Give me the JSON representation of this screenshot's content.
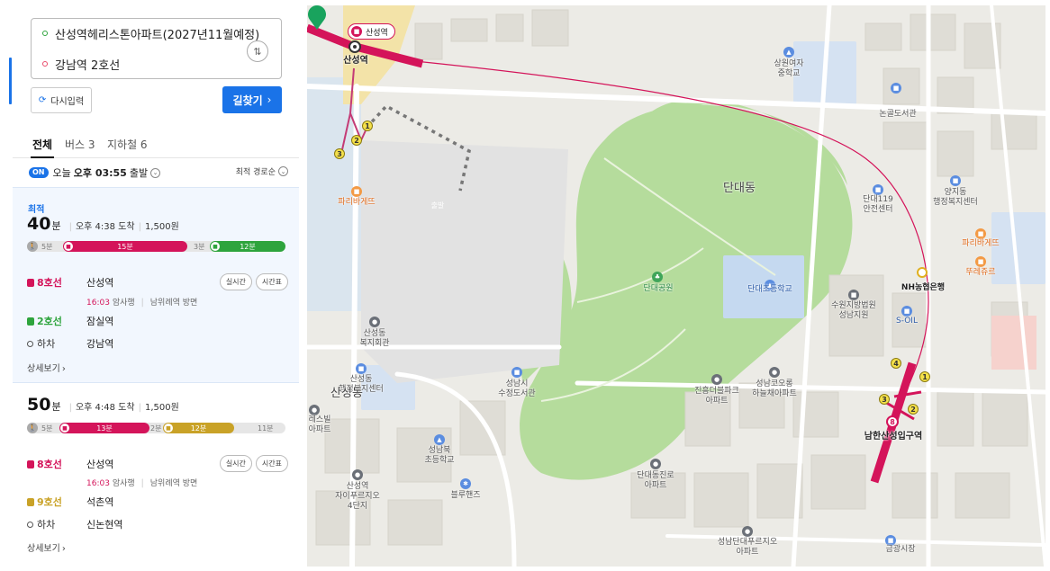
{
  "search": {
    "origin": "산성역헤리스톤아파트(2027년11월예정)",
    "destination": "강남역 2호선",
    "reset_label": "다시입력",
    "search_label": "길찾기"
  },
  "tabs": [
    {
      "label": "전체"
    },
    {
      "label": "버스 3"
    },
    {
      "label": "지하철 6"
    }
  ],
  "depart": {
    "on_badge": "ON",
    "day": "오늘",
    "time": "오후 03:55",
    "suffix": "출발",
    "sort": "최적 경로순"
  },
  "routes": [
    {
      "label": "최적",
      "minutes": "40",
      "minutes_unit": "분",
      "arrival": "오후 4:38 도착",
      "fare": "1,500원",
      "walk1": "5분",
      "seg1": {
        "text": "15분",
        "color": "#d4145a"
      },
      "gap": "3분",
      "seg2": {
        "text": "12분",
        "color": "#2ea43d"
      },
      "steps": [
        {
          "line": "8호선",
          "station": "산성역",
          "color": "#d4145a"
        },
        {
          "line": "2호선",
          "station": "잠실역",
          "color": "#2ea43d"
        },
        {
          "line": "하차",
          "station": "강남역"
        }
      ],
      "sub_time": "16:03",
      "sub_dir": "암사행",
      "sub_door": "남위례역 방면",
      "realtime": "실시간",
      "timetable": "시간표",
      "detail": "상세보기"
    },
    {
      "minutes": "50",
      "minutes_unit": "분",
      "arrival": "오후 4:48 도착",
      "fare": "1,500원",
      "walk1": "5분",
      "seg1": {
        "text": "13분",
        "color": "#d4145a"
      },
      "gap": "2분",
      "seg2": {
        "text": "12분",
        "color": "#c9a227"
      },
      "tail": "11분",
      "steps": [
        {
          "line": "8호선",
          "station": "산성역",
          "color": "#d4145a"
        },
        {
          "line": "9호선",
          "station": "석촌역",
          "color": "#c9a227"
        },
        {
          "line": "하차",
          "station": "신논현역"
        }
      ],
      "sub_time": "16:03",
      "sub_dir": "암사행",
      "sub_door": "남위례역 방면",
      "realtime": "실시간",
      "timetable": "시간표",
      "detail": "상세보기"
    }
  ],
  "map": {
    "station_tag": "산성역",
    "depart_pin": "출발",
    "labels": {
      "sanseong": "산성역",
      "dandae": "단대동",
      "park": "단대공원",
      "dandae_elem": "단대초등학교",
      "girls_high": "상원여자\n중학교",
      "nongol": "논골도서관",
      "fire": "단대119\n안전센터",
      "yangji": "양지동\n행정복지센터",
      "paris1": "파리바게뜨",
      "paris2": "파리바게뜨",
      "tous": "뚜레쥬르",
      "nh": "NH농협은행",
      "court": "수원지방법원\n성남지원",
      "soil": "S-OIL",
      "namhansanseong": "남한산성입구역",
      "sanseongdong": "산성동\n복지회관",
      "sanseong_admin": "산성동\n행정복지센터",
      "sanseong_big": "산성동",
      "library": "성남시\n수정도서관",
      "jinheung": "진흥더블파크\n아파트",
      "kolon": "성남코오롱\n하늘채아파트",
      "dandaejinro": "단대동진로\n아파트",
      "bukelem": "성남북\n초등학교",
      "bluehands": "블루핸즈",
      "xi": "산성역\n자이푸르지오\n4단지",
      "dandaepru": "성남단대푸르지오\n아파트",
      "market": "금광시장",
      "rest": "레스빌\n아파트"
    },
    "exits": [
      "1",
      "2",
      "3",
      "4",
      "8"
    ]
  }
}
